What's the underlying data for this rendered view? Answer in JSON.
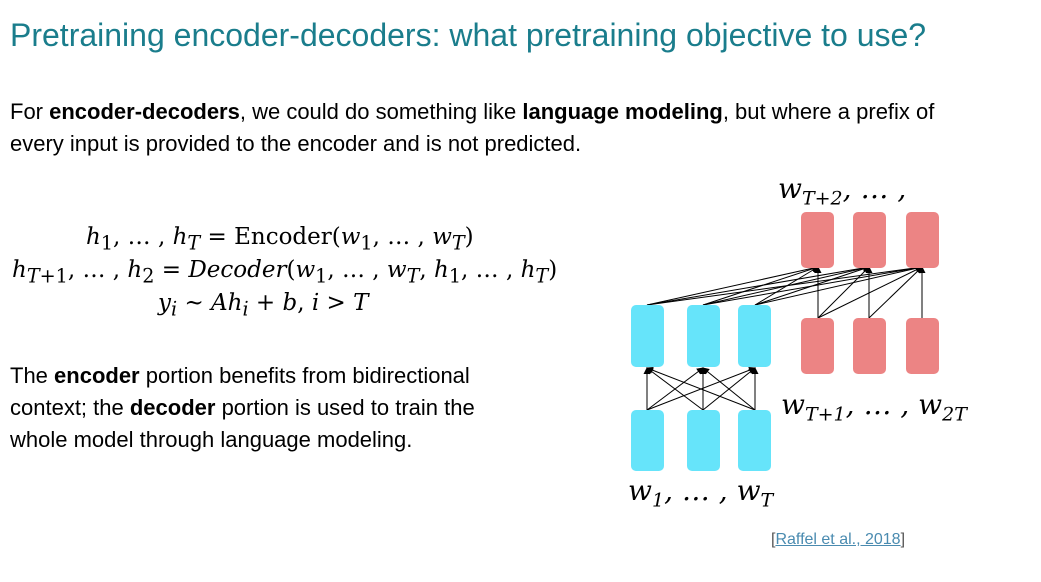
{
  "slide": {
    "title": "Pretraining encoder-decoders: what pretraining objective to use?",
    "intro": {
      "part1": "For ",
      "bold1": "encoder-decoders",
      "part2": ", we could do something like ",
      "bold2": "language modeling",
      "part3": ", but where a prefix of every input is provided to the encoder and is not predicted."
    },
    "equations": {
      "line1": "h₁, … , h_T = Encoder(w₁, … , w_T)",
      "line2": "h_{T+1}, … , h₂ = Decoder(w₁, … , w_T, h₁, … , h_T)",
      "line3": "y_i ~ Ah_i + b, i > T"
    },
    "description": {
      "part1": "The ",
      "bold1": "encoder",
      "part2": " portion benefits from bidirectional context; the ",
      "bold2": "decoder",
      "part3": " portion is used to train the whole model through language modeling."
    },
    "citation": {
      "open": "[",
      "link_text": "Raffel et al., 2018",
      "close": "]"
    }
  },
  "diagram": {
    "top_label": "w_{T+2}, … ,",
    "middle_label": "w_{T+1}, … , w_{2T}",
    "bottom_label": "w₁, … , w_T",
    "colors": {
      "encoder": "#66e4fa",
      "decoder": "#ec8484",
      "accent": "#1a7d8c"
    }
  }
}
